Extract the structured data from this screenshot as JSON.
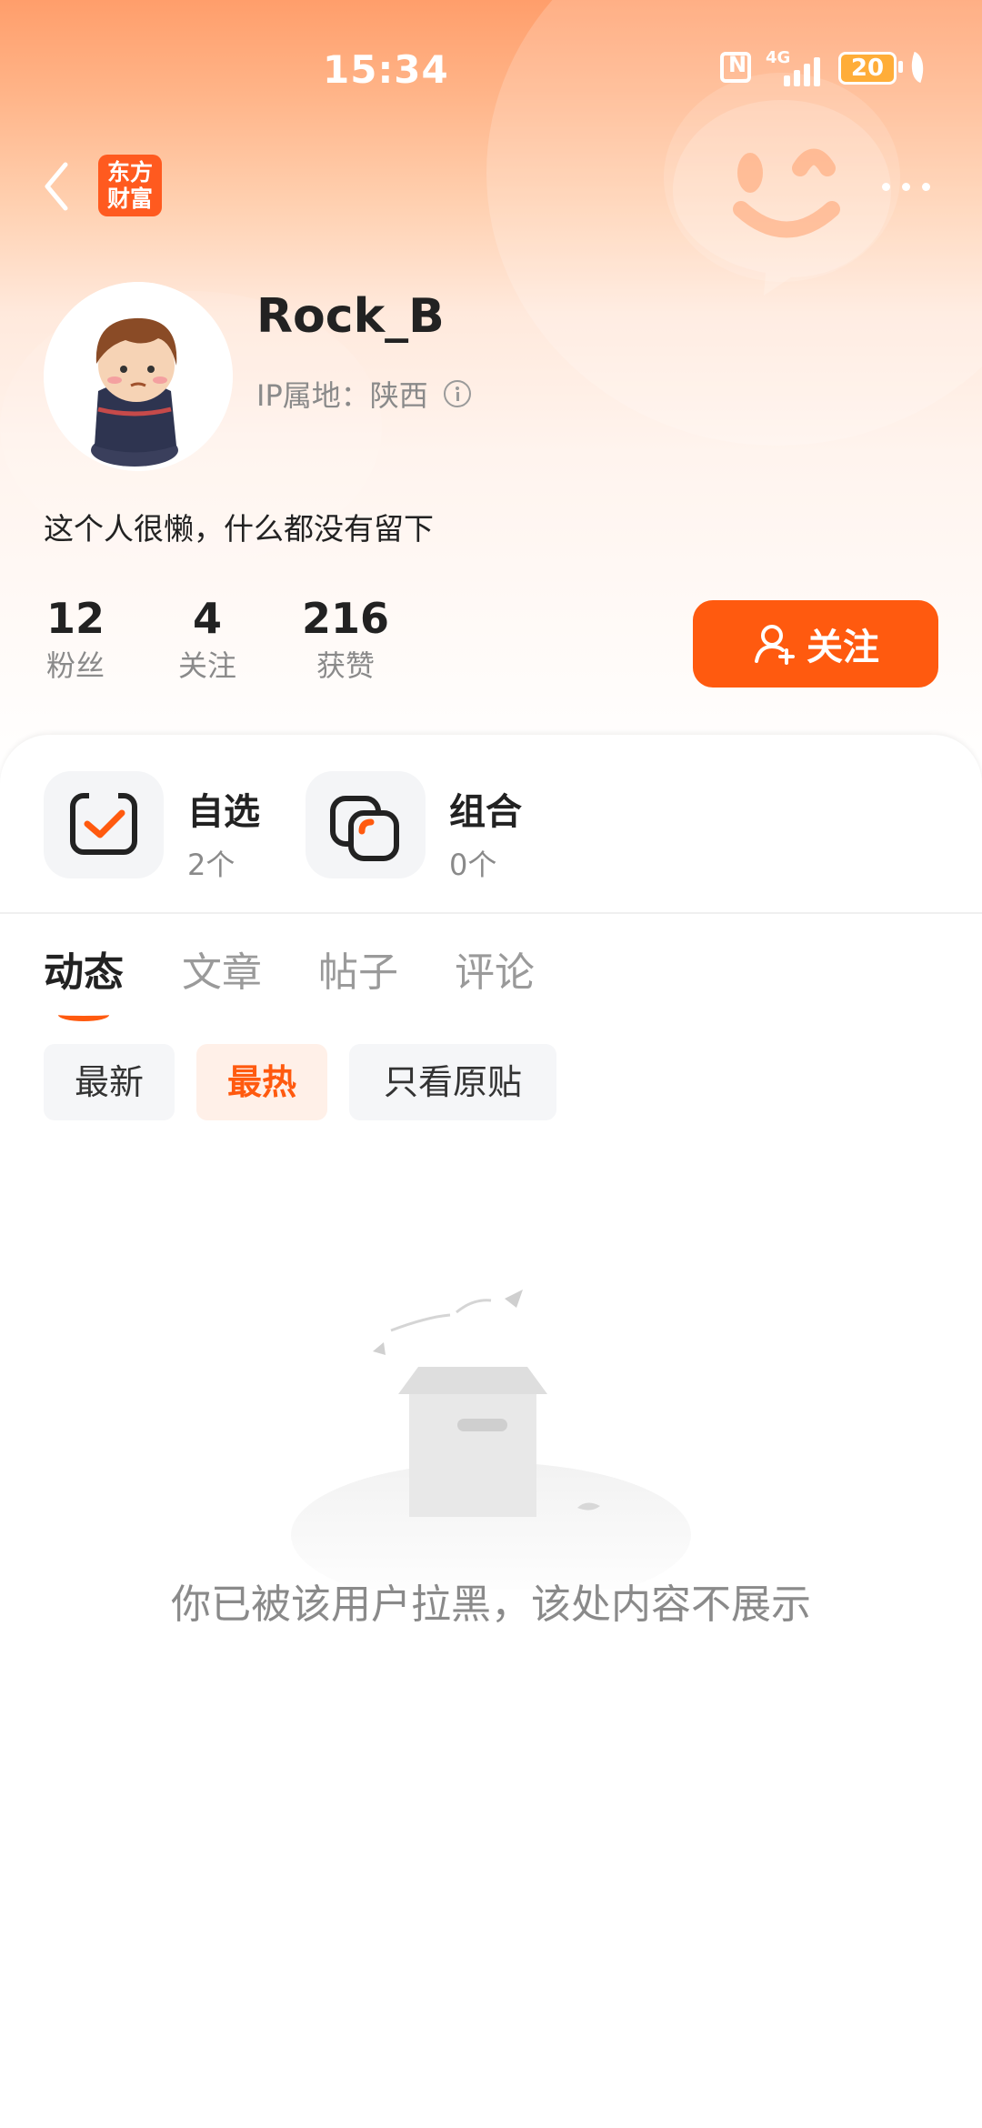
{
  "status_bar": {
    "time": "15:34",
    "network": "4G",
    "battery": "20"
  },
  "nav": {
    "logo_line1": "东方",
    "logo_line2": "财富"
  },
  "profile": {
    "username": "Rock_B",
    "ip_location": "IP属地：陕西",
    "bio": "这个人很懒，什么都没有留下"
  },
  "stats": [
    {
      "value": "12",
      "label": "粉丝"
    },
    {
      "value": "4",
      "label": "关注"
    },
    {
      "value": "216",
      "label": "获赞"
    }
  ],
  "follow_button": {
    "label": "关注"
  },
  "tools": [
    {
      "title": "自选",
      "count": "2个"
    },
    {
      "title": "组合",
      "count": "0个"
    }
  ],
  "tabs": [
    {
      "label": "动态",
      "active": true
    },
    {
      "label": "文章",
      "active": false
    },
    {
      "label": "帖子",
      "active": false
    },
    {
      "label": "评论",
      "active": false
    }
  ],
  "filters": [
    {
      "label": "最新",
      "active": false
    },
    {
      "label": "最热",
      "active": true
    },
    {
      "label": "只看原贴",
      "active": false
    }
  ],
  "empty_state": {
    "message": "你已被该用户拉黑，该处内容不展示"
  },
  "colors": {
    "accent": "#ff5a0f",
    "muted_text": "#8a8a8a"
  }
}
